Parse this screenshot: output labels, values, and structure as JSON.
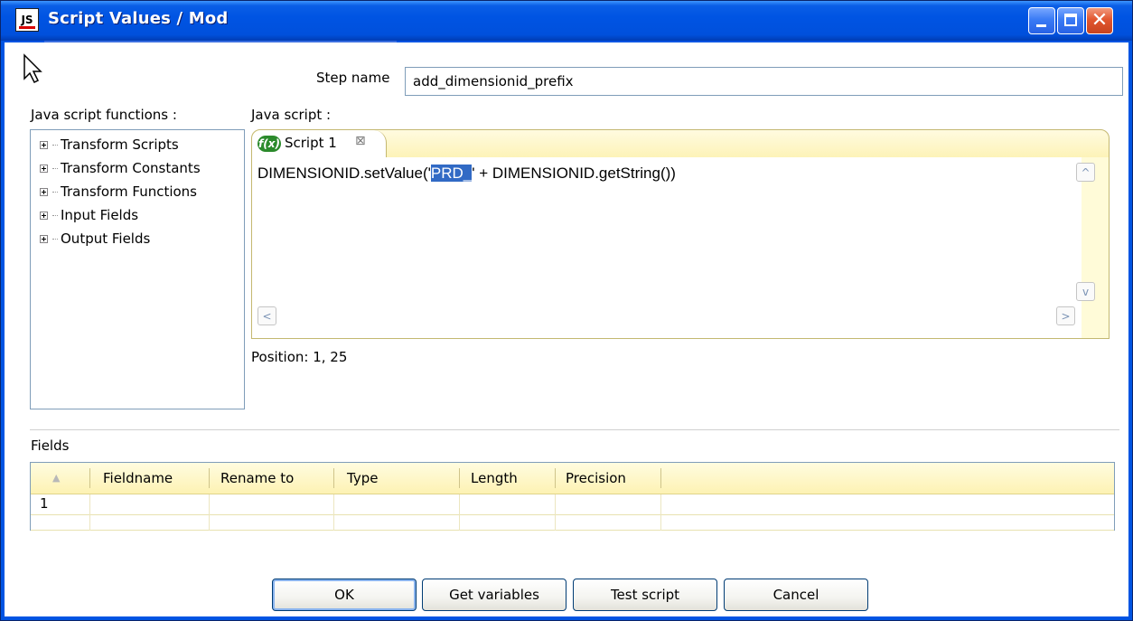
{
  "window": {
    "title": "Script Values / Mod",
    "icon_text": "JS",
    "controls": [
      "minimize",
      "maximize",
      "close"
    ],
    "close_glyph": "✕"
  },
  "step": {
    "label": "Step name",
    "value": "add_dimensionid_prefix"
  },
  "functions_panel": {
    "label": "Java script functions :",
    "items": [
      {
        "label": "Transform Scripts"
      },
      {
        "label": "Transform Constants"
      },
      {
        "label": "Transform Functions"
      },
      {
        "label": "Input Fields"
      },
      {
        "label": "Output Fields"
      }
    ]
  },
  "editor": {
    "label": "Java script :",
    "tab": {
      "icon_text": "f(x)",
      "label": "Script 1",
      "close_glyph": "⊠"
    },
    "code": {
      "before": "DIMENSIONID.setValue('",
      "selected": "PRD_",
      "after": "' + DIMENSIONID.getString())"
    },
    "position_text": "Position: 1, 25",
    "scroll_up": "^",
    "scroll_down": "v",
    "scroll_left": "<",
    "scroll_right": ">"
  },
  "fields": {
    "label": "Fields",
    "sort_glyph": "▲",
    "columns": [
      "Fieldname",
      "Rename to",
      "Type",
      "Length",
      "Precision"
    ],
    "rows": [
      {
        "num": "1",
        "fieldname": "",
        "rename_to": "",
        "type": "",
        "length": "",
        "precision": ""
      }
    ]
  },
  "buttons": {
    "ok": "OK",
    "get_variables": "Get variables",
    "test_script": "Test script",
    "cancel": "Cancel"
  },
  "colors": {
    "titlebar": "#0054e3",
    "selection": "#316ac5",
    "header_yellow": "#fdf2b3",
    "fx_green": "#2b8a2b"
  }
}
